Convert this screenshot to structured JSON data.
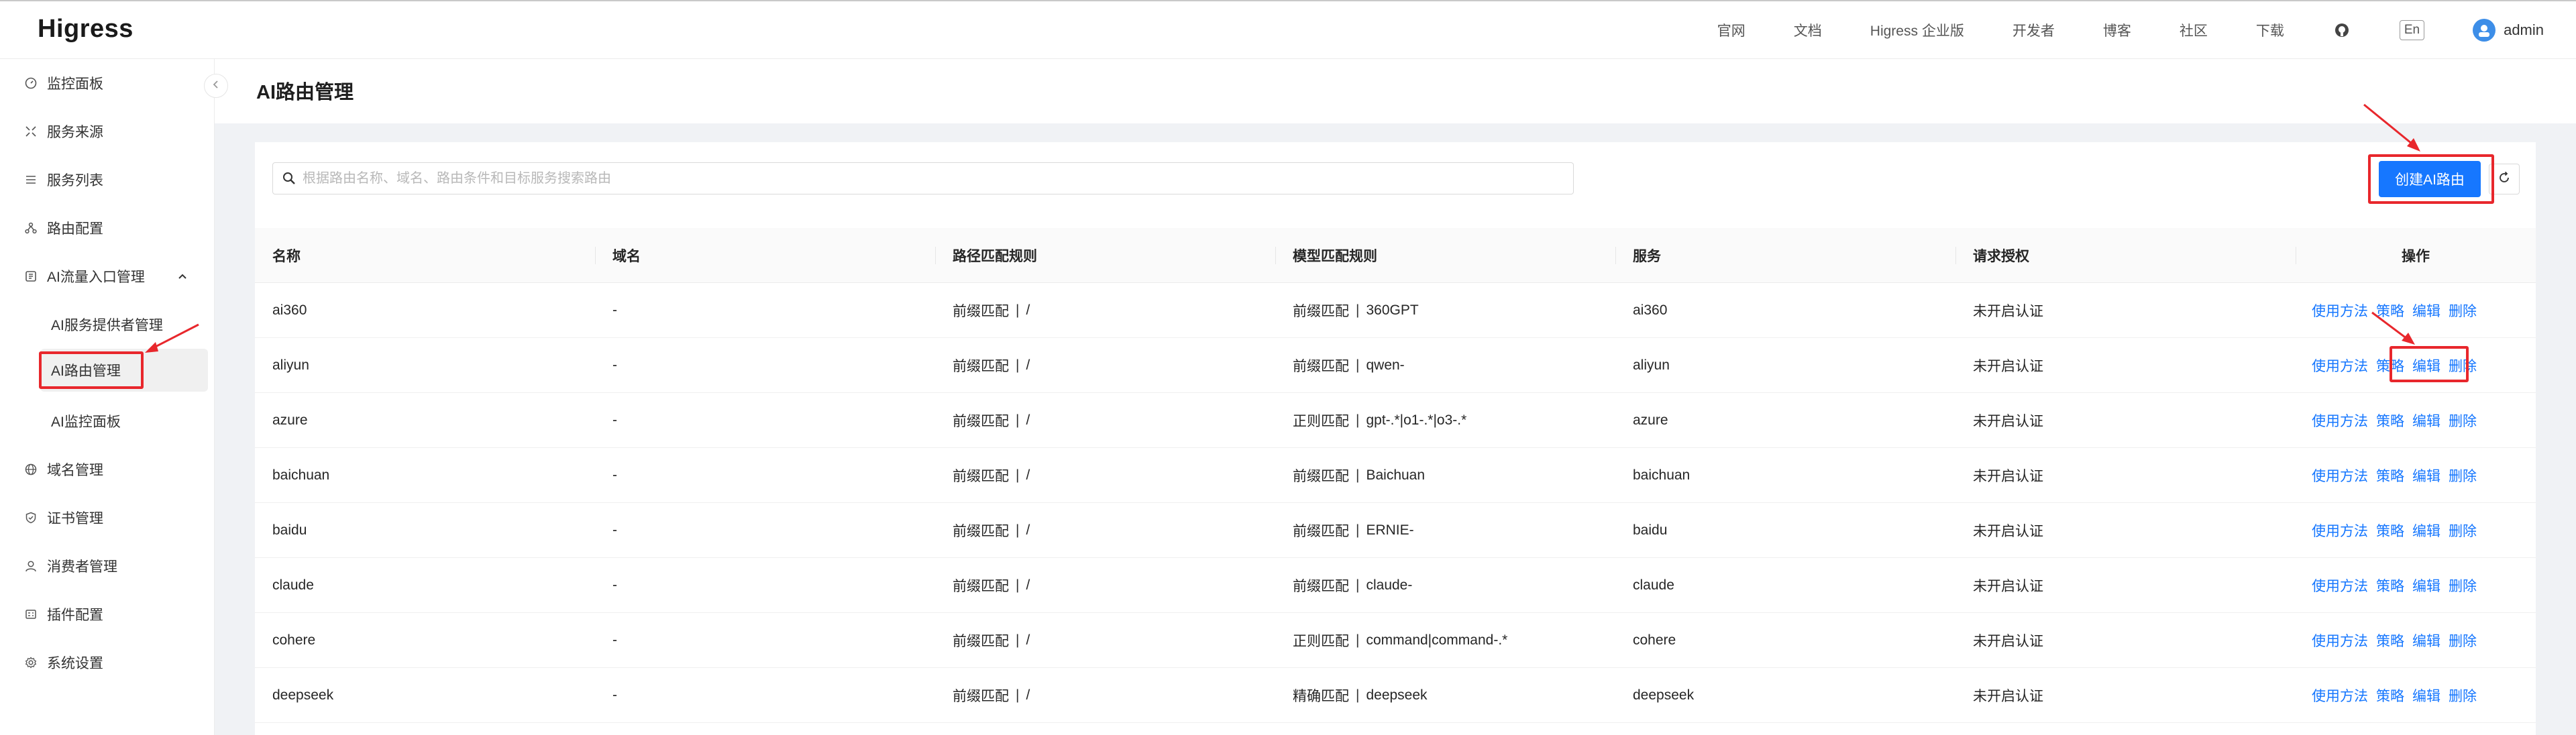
{
  "header": {
    "logo": "Higress",
    "nav": [
      "官网",
      "文档",
      "Higress 企业版",
      "开发者",
      "博客",
      "社区",
      "下载"
    ],
    "lang": "En",
    "user": "admin"
  },
  "sidebar": {
    "items": [
      {
        "label": "监控面板",
        "icon": "dashboard-icon"
      },
      {
        "label": "服务来源",
        "icon": "source-icon"
      },
      {
        "label": "服务列表",
        "icon": "list-icon"
      },
      {
        "label": "路由配置",
        "icon": "route-icon"
      },
      {
        "label": "AI流量入口管理",
        "icon": "ai-gateway-icon"
      },
      {
        "label": "AI服务提供者管理",
        "icon": ""
      },
      {
        "label": "AI路由管理",
        "icon": ""
      },
      {
        "label": "AI监控面板",
        "icon": ""
      },
      {
        "label": "域名管理",
        "icon": "globe-icon"
      },
      {
        "label": "证书管理",
        "icon": "shield-icon"
      },
      {
        "label": "消费者管理",
        "icon": "user-icon"
      },
      {
        "label": "插件配置",
        "icon": "plugin-icon"
      },
      {
        "label": "系统设置",
        "icon": "gear-icon"
      }
    ]
  },
  "page": {
    "title": "AI路由管理",
    "search_placeholder": "根据路由名称、域名、路由条件和目标服务搜索路由",
    "create_label": "创建AI路由"
  },
  "table": {
    "headers": [
      "名称",
      "域名",
      "路径匹配规则",
      "模型匹配规则",
      "服务",
      "请求授权",
      "操作"
    ],
    "ops": [
      "使用方法",
      "策略",
      "编辑",
      "删除"
    ],
    "rows": [
      {
        "name": "ai360",
        "domain": "-",
        "path_type": "前缀匹配",
        "path": "/",
        "model_type": "前缀匹配",
        "model": "360GPT",
        "service": "ai360",
        "auth": "未开启认证"
      },
      {
        "name": "aliyun",
        "domain": "-",
        "path_type": "前缀匹配",
        "path": "/",
        "model_type": "前缀匹配",
        "model": "qwen-",
        "service": "aliyun",
        "auth": "未开启认证"
      },
      {
        "name": "azure",
        "domain": "-",
        "path_type": "前缀匹配",
        "path": "/",
        "model_type": "正则匹配",
        "model": "gpt-.*|o1-.*|o3-.*",
        "service": "azure",
        "auth": "未开启认证"
      },
      {
        "name": "baichuan",
        "domain": "-",
        "path_type": "前缀匹配",
        "path": "/",
        "model_type": "前缀匹配",
        "model": "Baichuan",
        "service": "baichuan",
        "auth": "未开启认证"
      },
      {
        "name": "baidu",
        "domain": "-",
        "path_type": "前缀匹配",
        "path": "/",
        "model_type": "前缀匹配",
        "model": "ERNIE-",
        "service": "baidu",
        "auth": "未开启认证"
      },
      {
        "name": "claude",
        "domain": "-",
        "path_type": "前缀匹配",
        "path": "/",
        "model_type": "前缀匹配",
        "model": "claude-",
        "service": "claude",
        "auth": "未开启认证"
      },
      {
        "name": "cohere",
        "domain": "-",
        "path_type": "前缀匹配",
        "path": "/",
        "model_type": "正则匹配",
        "model": "command|command-.*",
        "service": "cohere",
        "auth": "未开启认证"
      },
      {
        "name": "deepseek",
        "domain": "-",
        "path_type": "前缀匹配",
        "path": "/",
        "model_type": "精确匹配",
        "model": "deepseek",
        "service": "deepseek",
        "auth": "未开启认证"
      }
    ]
  },
  "colors": {
    "primary": "#1677ff",
    "highlight": "#e8272c"
  }
}
